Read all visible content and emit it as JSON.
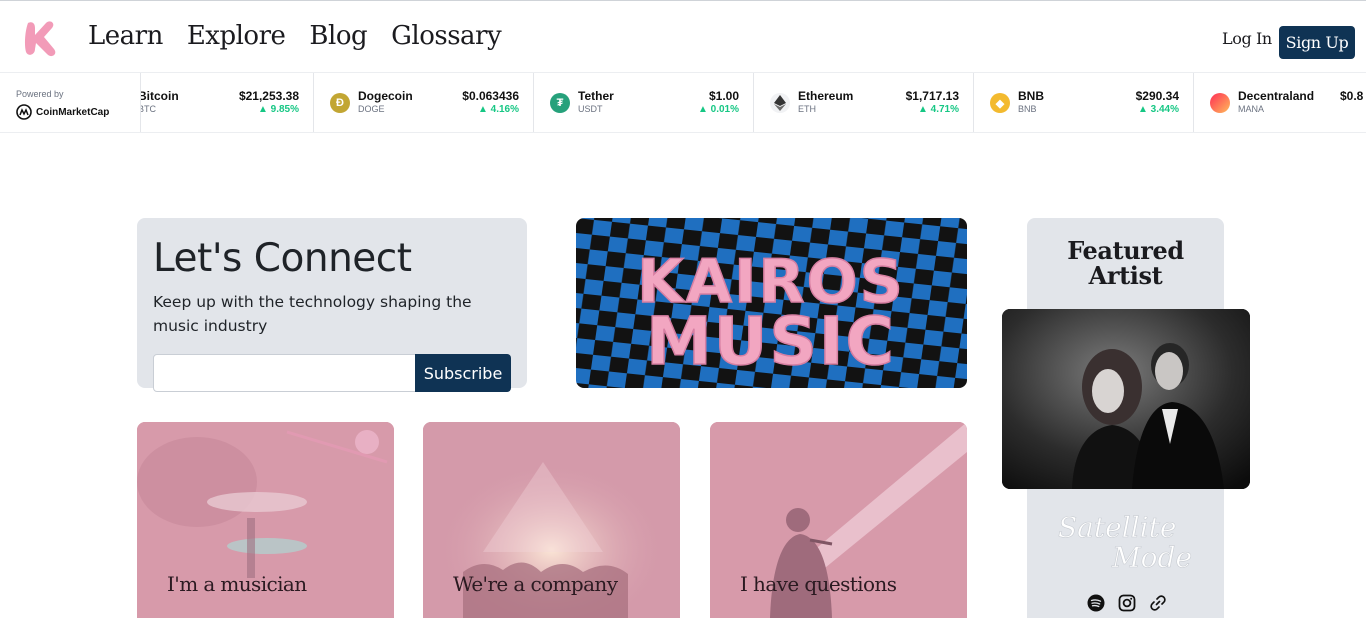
{
  "header": {
    "nav": [
      "Learn",
      "Explore",
      "Blog",
      "Glossary"
    ],
    "login_label": "Log In",
    "signup_label": "Sign Up",
    "logo_icon": "kairos-k-logo-icon",
    "colors": {
      "primary": "#0f3354",
      "brand_pink": "#f29bb8"
    }
  },
  "ticker": {
    "powered_by": "Powered by",
    "provider": "CoinMarketCap",
    "coins": [
      {
        "name": "Bitcoin",
        "symbol": "BTC",
        "price": "$21,253.38",
        "change": "▲ 9.85%",
        "icon": "bitcoin-icon",
        "color": "#f7931a"
      },
      {
        "name": "Dogecoin",
        "symbol": "DOGE",
        "price": "$0.063436",
        "change": "▲ 4.16%",
        "icon": "dogecoin-icon",
        "color": "#c2a633"
      },
      {
        "name": "Tether",
        "symbol": "USDT",
        "price": "$1.00",
        "change": "▲ 0.01%",
        "icon": "tether-icon",
        "color": "#26a17b"
      },
      {
        "name": "Ethereum",
        "symbol": "ETH",
        "price": "$1,717.13",
        "change": "▲ 4.71%",
        "icon": "ethereum-icon",
        "color": "#627eea"
      },
      {
        "name": "BNB",
        "symbol": "BNB",
        "price": "$290.34",
        "change": "▲ 3.44%",
        "icon": "bnb-icon",
        "color": "#f3ba2f"
      },
      {
        "name": "Decentraland",
        "symbol": "MANA",
        "price": "$0.8",
        "change": "",
        "icon": "decentraland-icon",
        "color": "#ff2d55"
      }
    ],
    "positive_color": "#16c784"
  },
  "connect": {
    "title": "Let's Connect",
    "subtitle": "Keep up with the technology shaping the music industry",
    "email_value": "",
    "subscribe_label": "Subscribe"
  },
  "banner": {
    "line1": "KAIROS",
    "line2": "MUSIC"
  },
  "featured": {
    "title": "Featured Artist",
    "artist_signature": "Satellite Mode",
    "socials": [
      "spotify-icon",
      "instagram-icon",
      "link-icon"
    ]
  },
  "cards": [
    {
      "label": "I'm a musician"
    },
    {
      "label": "We're a company"
    },
    {
      "label": "I have questions"
    }
  ]
}
